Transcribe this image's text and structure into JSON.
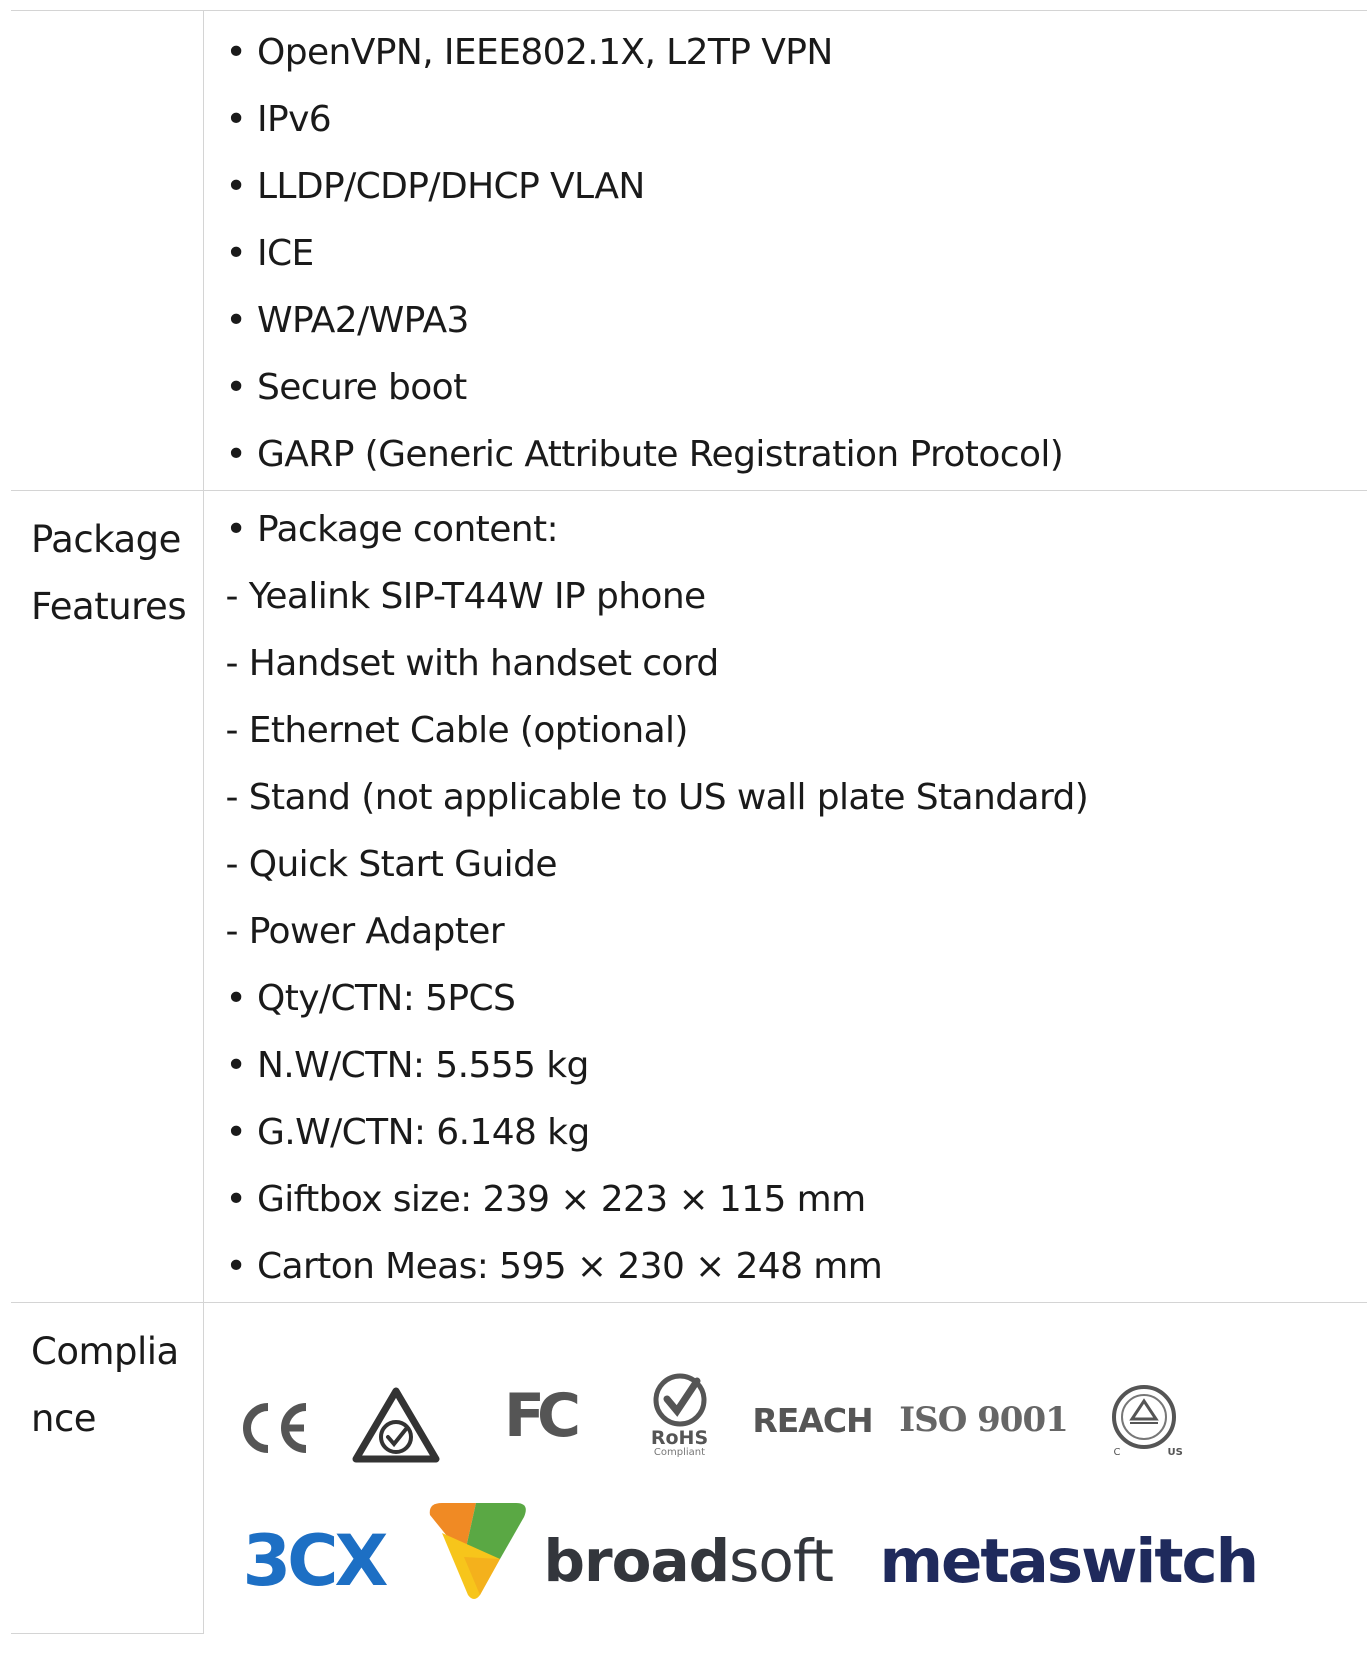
{
  "rows": [
    {
      "label": "",
      "items": [
        "• OpenVPN, IEEE802.1X, L2TP VPN",
        "• IPv6",
        "• LLDP/CDP/DHCP VLAN",
        "• ICE",
        "• WPA2/WPA3",
        "• Secure boot",
        "• GARP (Generic Attribute Registration Protocol)"
      ]
    },
    {
      "label": "Package Features",
      "label_lines": [
        "Package",
        "Features"
      ],
      "items": [
        "• Package content:",
        "- Yealink SIP-T44W IP phone",
        "- Handset with handset cord",
        "- Ethernet Cable (optional)",
        "- Stand (not applicable to US wall plate Standard)",
        "- Quick Start Guide",
        "- Power Adapter",
        "• Qty/CTN: 5PCS",
        "• N.W/CTN: 5.555 kg",
        "• G.W/CTN: 6.148 kg",
        "• Giftbox size: 239 × 223 × 115 mm",
        "• Carton Meas: 595 × 230 × 248 mm"
      ]
    },
    {
      "label": "Compliance",
      "label_lines": [
        "Complia",
        "nce"
      ]
    }
  ],
  "compliance_logos": {
    "ce": "CE",
    "fcc": "FC",
    "rohs": "RoHS",
    "rohs_sub": "Compliant",
    "reach": "REACH",
    "iso": "ISO 9001",
    "tuv_c": "C",
    "tuv_us": "US",
    "tuv_inner": "TÜVRheinland"
  },
  "partner_logos": {
    "threecx": "3CX",
    "broadsoft_bold": "broad",
    "broadsoft_light": "soft",
    "metaswitch": "metaswitch"
  },
  "colors": {
    "border": "#d4d4d4",
    "text": "#1a1a1a",
    "logo_gray": "#555555",
    "threecx_blue": "#1d6fc4",
    "broadsoft_dark": "#33363c",
    "metaswitch_navy": "#1f2a5c",
    "broadsoft_orange": "#f08a24",
    "broadsoft_yellow": "#f7c51b",
    "broadsoft_green": "#5aa844"
  }
}
